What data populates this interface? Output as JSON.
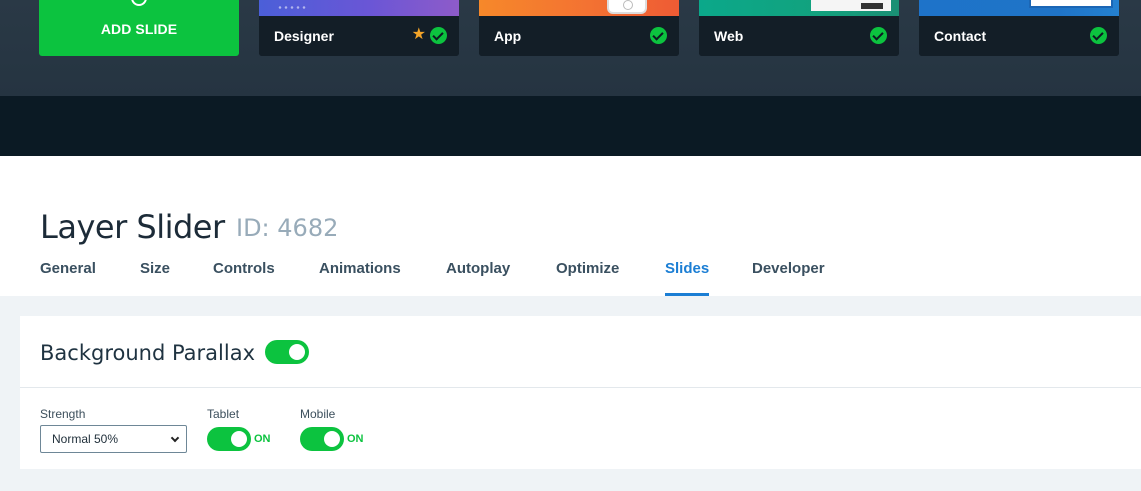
{
  "slides_strip": {
    "add_button_label": "ADD SLIDE",
    "slides": [
      {
        "name": "Designer",
        "starred": true,
        "enabled": true
      },
      {
        "name": "App",
        "starred": false,
        "enabled": true
      },
      {
        "name": "Web",
        "starred": false,
        "enabled": true
      },
      {
        "name": "Contact",
        "starred": false,
        "enabled": true
      }
    ]
  },
  "header": {
    "title": "Layer Slider",
    "id_label": "ID: 4682"
  },
  "tabs": [
    {
      "label": "General"
    },
    {
      "label": "Size"
    },
    {
      "label": "Controls"
    },
    {
      "label": "Animations"
    },
    {
      "label": "Autoplay"
    },
    {
      "label": "Optimize"
    },
    {
      "label": "Slides",
      "active": true
    },
    {
      "label": "Developer"
    }
  ],
  "parallax": {
    "title": "Background Parallax",
    "enabled": true,
    "strength_label": "Strength",
    "strength_value": "Normal 50%",
    "tablet_label": "Tablet",
    "tablet_state": "ON",
    "mobile_label": "Mobile",
    "mobile_state": "ON"
  },
  "colors": {
    "accent_green": "#0cc33f",
    "tab_active": "#1b7ed4",
    "dark_band": "#0b1a24",
    "star": "#f4a529"
  }
}
